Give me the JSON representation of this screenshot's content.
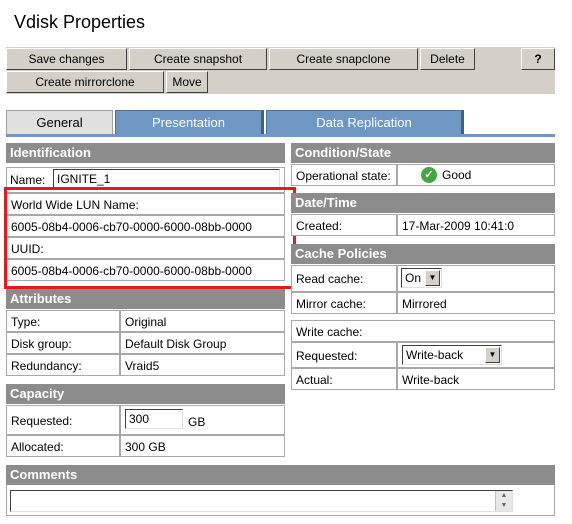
{
  "page": {
    "title": "Vdisk Properties"
  },
  "toolbar": {
    "save_label": "Save changes",
    "snapshot_label": "Create snapshot",
    "snapclone_label": "Create snapclone",
    "delete_label": "Delete",
    "help_label": "?",
    "mirrorclone_label": "Create mirrorclone",
    "move_label": "Move"
  },
  "tabs": [
    {
      "label": "General",
      "active": true
    },
    {
      "label": "Presentation",
      "active": false
    },
    {
      "label": "Data Replication",
      "active": false
    }
  ],
  "identification": {
    "heading": "Identification",
    "name_label": "Name:",
    "name_value": "IGNITE_1",
    "wwn_label": "World Wide LUN Name:",
    "wwn_value": "6005-08b4-0006-cb70-0000-6000-08bb-0000",
    "uuid_label": "UUID:",
    "uuid_value": "6005-08b4-0006-cb70-0000-6000-08bb-0000"
  },
  "attributes": {
    "heading": "Attributes",
    "rows": [
      {
        "label": "Type:",
        "value": "Original"
      },
      {
        "label": "Disk group:",
        "value": "Default Disk Group"
      },
      {
        "label": "Redundancy:",
        "value": "Vraid5"
      }
    ]
  },
  "capacity": {
    "heading": "Capacity",
    "requested_label": "Requested:",
    "requested_value": "300",
    "requested_unit": "GB",
    "allocated_label": "Allocated:",
    "allocated_value": "300 GB"
  },
  "condition": {
    "heading": "Condition/State",
    "state_label": "Operational state:",
    "state_value": "Good",
    "state_color": "#43a83f"
  },
  "datetime": {
    "heading": "Date/Time",
    "created_label": "Created:",
    "created_value": "17-Mar-2009 10:41:0"
  },
  "cache": {
    "heading": "Cache Policies",
    "read_label": "Read cache:",
    "read_value": "On",
    "mirror_label": "Mirror cache:",
    "mirror_value": "Mirrored",
    "write_label": "Write cache:",
    "write_requested_label": "Requested:",
    "write_requested_value": "Write-back",
    "write_actual_label": "Actual:",
    "write_actual_value": "Write-back"
  },
  "comments": {
    "heading": "Comments",
    "value": ""
  },
  "colors": {
    "accent_tab": "#6f97c4",
    "section_header": "#8c8c8c",
    "highlight": "#e01c1c"
  }
}
